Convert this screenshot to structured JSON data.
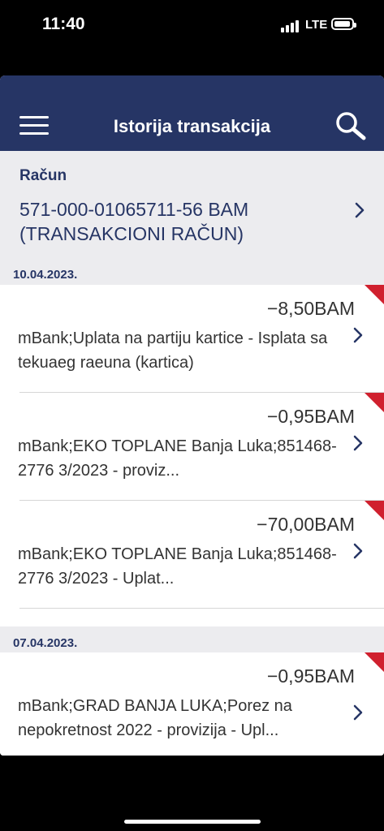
{
  "status": {
    "time": "11:40",
    "network": "LTE"
  },
  "header": {
    "title": "Istorija transakcija"
  },
  "account": {
    "label": "Račun",
    "value": "571-000-01065711-56 BAM (TRANSAKCIONI RAČUN)"
  },
  "groups": [
    {
      "date": "10.04.2023.",
      "transactions": [
        {
          "amount": "−8,50BAM",
          "description": "mBank;Uplata na partiju kartice - Isplata sa tekuaeg raeuna (kartica)"
        },
        {
          "amount": "−0,95BAM",
          "description": "mBank;EKO TOPLANE Banja Luka;851468-2776 3/2023 - proviz..."
        },
        {
          "amount": "−70,00BAM",
          "description": "mBank;EKO TOPLANE Banja Luka;851468-2776 3/2023 - Uplat..."
        }
      ]
    },
    {
      "date": "07.04.2023.",
      "transactions": [
        {
          "amount": "−0,95BAM",
          "description": "mBank;GRAD BANJA LUKA;Porez na nepokretnost 2022 - provizija - Upl..."
        }
      ]
    }
  ],
  "colors": {
    "primary": "#263565",
    "flag": "#d0202e",
    "section_bg": "#ececef"
  },
  "icons": {
    "menu": "hamburger-menu-icon",
    "search": "search-icon",
    "chevron": "chevron-right-icon",
    "flag": "unread-flag"
  }
}
